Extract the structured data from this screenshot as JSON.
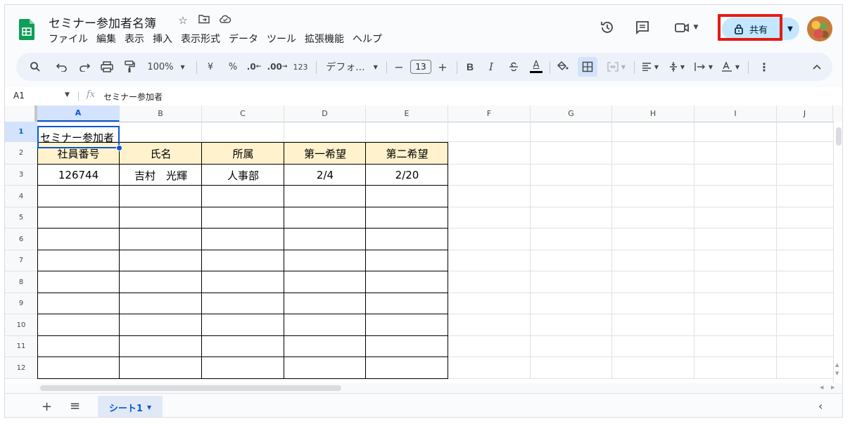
{
  "doc": {
    "title": "セミナー参加者名簿",
    "menu": [
      "ファイル",
      "編集",
      "表示",
      "挿入",
      "表示形式",
      "データ",
      "ツール",
      "拡張機能",
      "ヘルプ"
    ]
  },
  "header": {
    "share_label": "共有",
    "title_icons": [
      "star-icon",
      "move-folder-icon",
      "cloud-status-icon"
    ],
    "right_icons": [
      "history-icon",
      "comments-icon",
      "meet-icon"
    ]
  },
  "toolbar": {
    "zoom": "100%",
    "currency": "¥",
    "percent": "%",
    "decimal_decrease": ".0",
    "decimal_increase": ".00",
    "number_format": "123",
    "font": "デフォ...",
    "font_size": "13",
    "bold": "B",
    "italic": "I",
    "text_color": "A"
  },
  "formula_bar": {
    "cell_ref": "A1",
    "fx": "fx",
    "content": "セミナー参加者"
  },
  "grid": {
    "columns": [
      "A",
      "B",
      "C",
      "D",
      "E",
      "F",
      "G",
      "H",
      "I",
      "J"
    ],
    "rows": [
      "1",
      "2",
      "3",
      "4",
      "5",
      "6",
      "7",
      "8",
      "9",
      "10",
      "11",
      "12"
    ],
    "title_cell": "セミナー参加者",
    "table_headers": [
      "社員番号",
      "氏名",
      "所属",
      "第一希望",
      "第二希望"
    ],
    "table_rows": [
      [
        "126744",
        "吉村　光輝",
        "人事部",
        "2/4",
        "2/20"
      ]
    ],
    "header_fill": "#fff2cc"
  },
  "sheets": {
    "active": "シート1"
  },
  "colors": {
    "accent": "#0b57d0",
    "share_bg": "#c2e7ff",
    "highlight_box": "#e51a14"
  }
}
